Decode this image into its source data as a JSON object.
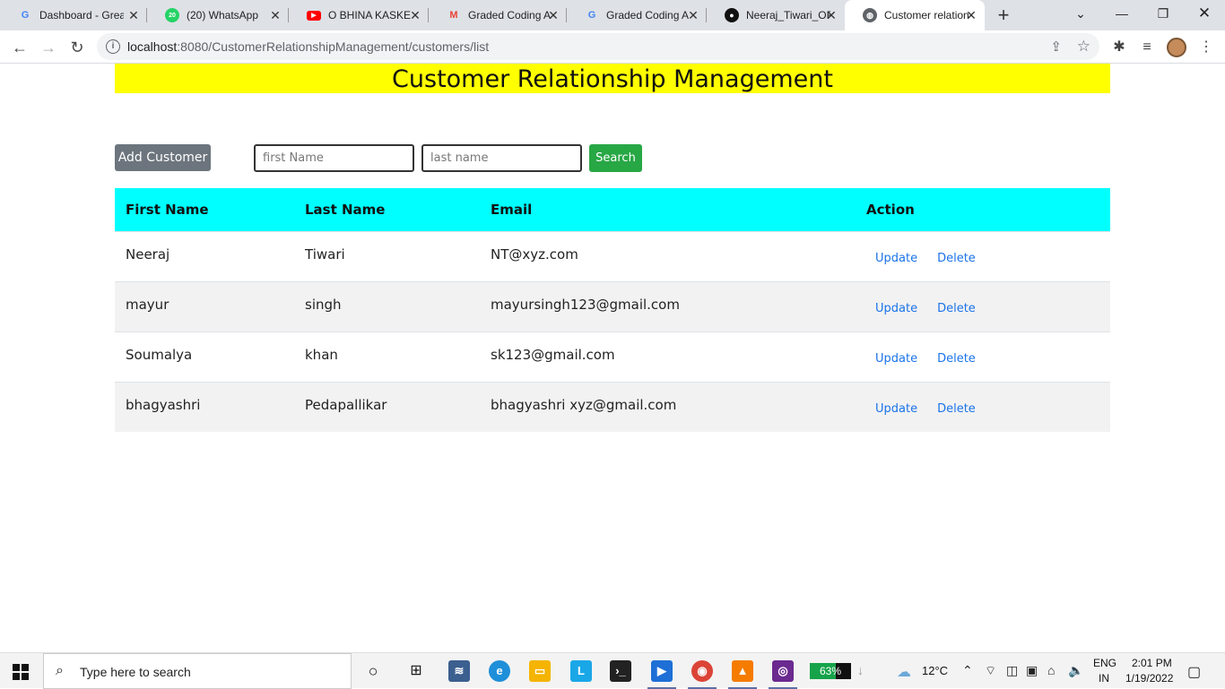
{
  "browser": {
    "tabs": [
      {
        "title": "Dashboard - Great",
        "favicon": "google-icon",
        "color": "#4285f4"
      },
      {
        "title": "(20) WhatsApp",
        "favicon": "whatsapp-icon",
        "color": "#25d366"
      },
      {
        "title": "O BHINA KASKE",
        "favicon": "youtube-icon",
        "color": "#ff0000"
      },
      {
        "title": "Graded Coding A",
        "favicon": "gmail-icon",
        "color": "#ea4335"
      },
      {
        "title": "Graded Coding A",
        "favicon": "google-icon",
        "color": "#4285f4"
      },
      {
        "title": "Neeraj_Tiwari_OF",
        "favicon": "github-icon",
        "color": "#111111"
      },
      {
        "title": "Customer relation",
        "favicon": "globe-icon",
        "color": "#5f6368"
      }
    ],
    "url_host": "localhost",
    "url_rest": ":8080/CustomerRelationshipManagement/customers/list"
  },
  "page": {
    "title": "Customer Relationship Management",
    "add_button": "Add Customer",
    "first_name_placeholder": "first Name",
    "last_name_placeholder": "last name",
    "search_button": "Search",
    "columns": [
      "First Name",
      "Last Name",
      "Email",
      "Action"
    ],
    "rows": [
      {
        "first": "Neeraj",
        "last": "Tiwari",
        "email": "NT@xyz.com"
      },
      {
        "first": "mayur",
        "last": "singh",
        "email": "mayursingh123@gmail.com"
      },
      {
        "first": "Soumalya",
        "last": "khan",
        "email": "sk123@gmail.com"
      },
      {
        "first": "bhagyashri",
        "last": "Pedapallikar",
        "email": "bhagyashri xyz@gmail.com"
      }
    ],
    "update_label": "Update",
    "delete_label": "Delete",
    "colors": {
      "header_bg": "#ffff00",
      "table_header_bg": "#00ffff",
      "search_btn": "#28a745",
      "add_btn": "#6c757d"
    }
  },
  "taskbar": {
    "search_placeholder": "Type here to search",
    "battery_percent": "63%",
    "battery_level": 0.63,
    "temperature": "12°C",
    "language": "ENG",
    "region": "IN",
    "time": "2:01 PM",
    "date": "1/19/2022"
  }
}
